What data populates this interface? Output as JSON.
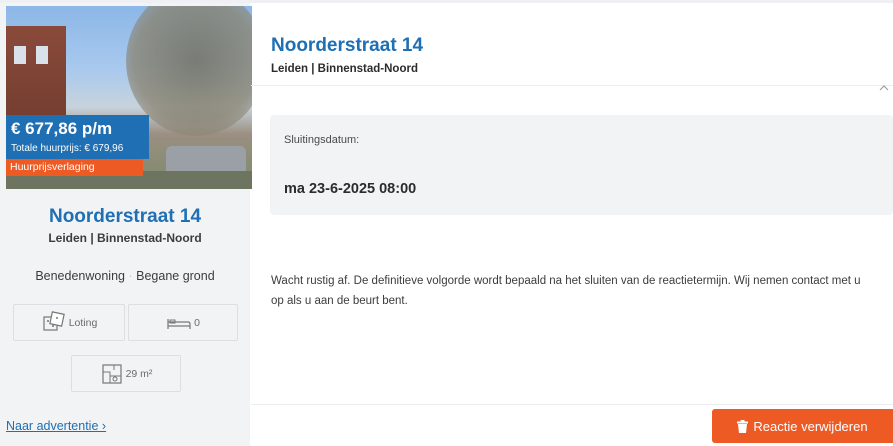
{
  "listing": {
    "price": "€ 677,86  p/m",
    "total_rent": "Totale huurprijs: € 679,96",
    "discount_badge": "Huurprijsverlaging",
    "street": "Noorderstraat 14",
    "location": "Leiden | Binnenstad-Noord",
    "dwelling_type": "Benedenwoning",
    "type_separator": "·",
    "floor": "Begane grond",
    "features": {
      "allocation": "Loting",
      "bedrooms": "0",
      "area": "29 m²"
    },
    "ad_link": "Naar advertentie ›"
  },
  "detail": {
    "title": "Noorderstraat 14",
    "subtitle": "Leiden | Binnenstad-Noord",
    "deadline_label": "Sluitingsdatum:",
    "deadline_value": "ma 23-6-2025 08:00",
    "message": "Wacht rustig af. De definitieve volgorde wordt bepaald na het sluiten van de reactietermijn. Wij nemen contact met u op als u aan de beurt bent.",
    "delete_button": "Reactie verwijderen"
  },
  "colors": {
    "brand_blue": "#1e6fb3",
    "accent_orange": "#ee5a24",
    "panel_gray": "#f2f3f4"
  },
  "icons": [
    "dice-icon",
    "bed-icon",
    "floorplan-icon",
    "trash-icon",
    "chevron-up-icon"
  ]
}
